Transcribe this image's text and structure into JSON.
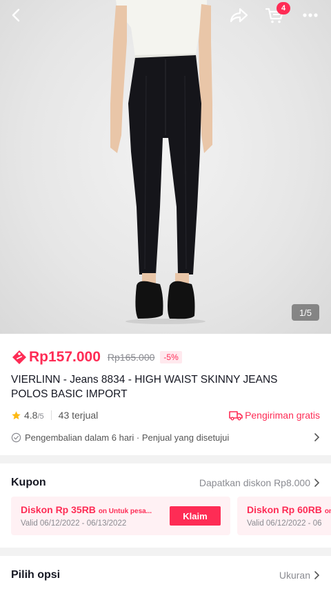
{
  "topbar": {
    "icons": [
      "back-icon",
      "share-icon",
      "cart-icon",
      "more-icon"
    ],
    "cart_count": "4"
  },
  "gallery": {
    "counter": "1/5"
  },
  "product": {
    "price": "Rp157.000",
    "original_price": "Rp165.000",
    "discount": "-5%",
    "title": "VIERLINN - Jeans 8834 - HIGH WAIST SKINNY JEANS POLOS BASIC IMPORT",
    "rating": "4.8",
    "rating_max": "/5",
    "sold": "43 terjual",
    "shipping": "Pengiriman gratis",
    "return_policy": "Pengembalian dalam 6 hari · Penjual yang disetujui"
  },
  "coupon": {
    "title": "Kupon",
    "link": "Dapatkan diskon Rp8.000",
    "items": [
      {
        "title": "Diskon Rp 35RB",
        "note": "on Untuk pesa...",
        "valid": "Valid 06/12/2022 - 06/13/2022",
        "button": "Klaim"
      },
      {
        "title": "Diskon Rp 60RB",
        "note": "on",
        "valid": "Valid 06/12/2022 - 06"
      }
    ]
  },
  "options": {
    "title": "Pilih opsi",
    "value": "Ukuran"
  },
  "colors": {
    "accent": "#fe2c55",
    "star": "#fdb913"
  }
}
